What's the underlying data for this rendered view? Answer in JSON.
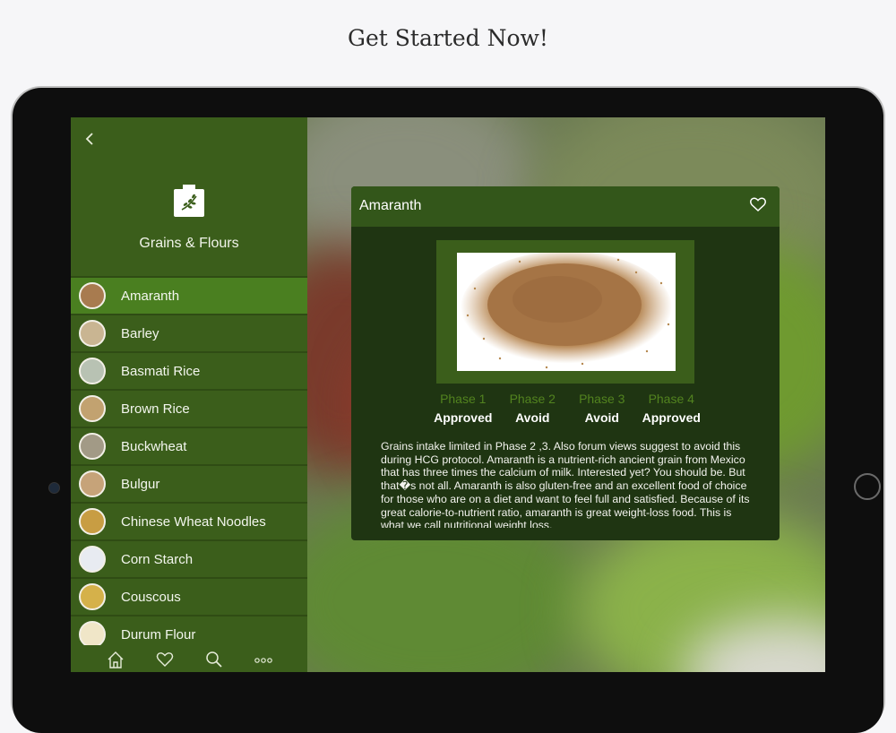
{
  "headline": "Get Started Now!",
  "sidebar": {
    "category_title": "Grains & Flours",
    "items": [
      {
        "label": "Amaranth",
        "selected": true,
        "color": "#a87b4f"
      },
      {
        "label": "Barley",
        "selected": false,
        "color": "#c9b592"
      },
      {
        "label": "Basmati Rice",
        "selected": false,
        "color": "#b8c2b3"
      },
      {
        "label": "Brown Rice",
        "selected": false,
        "color": "#c2a270"
      },
      {
        "label": "Buckwheat",
        "selected": false,
        "color": "#a29a86"
      },
      {
        "label": "Bulgur",
        "selected": false,
        "color": "#c6a379"
      },
      {
        "label": "Chinese Wheat Noodles",
        "selected": false,
        "color": "#c89d43"
      },
      {
        "label": "Corn Starch",
        "selected": false,
        "color": "#e8ebf1"
      },
      {
        "label": "Couscous",
        "selected": false,
        "color": "#d5b14a"
      },
      {
        "label": "Durum Flour",
        "selected": false,
        "color": "#f0e6c8"
      }
    ],
    "tabs": [
      "home-icon",
      "heart-icon",
      "search-icon",
      "more-icon"
    ]
  },
  "detail": {
    "title": "Amaranth",
    "phases": [
      {
        "name": "Phase 1",
        "status": "Approved"
      },
      {
        "name": "Phase 2",
        "status": "Avoid"
      },
      {
        "name": "Phase 3",
        "status": "Avoid"
      },
      {
        "name": "Phase 4",
        "status": "Approved"
      }
    ],
    "description": "Grains intake limited in Phase 2 ,3. Also forum views suggest to avoid this during HCG protocol. Amaranth is a nutrient-rich ancient grain from Mexico that has three times the calcium of milk. Interested yet? You should be. But that�s not all. Amaranth is also gluten-free and an excellent food of choice for those who are on a diet and want to feel full and satisfied. Because of its great calorie-to-nutrient ratio, amaranth is great weight-loss food. This is what we call nutritional weight loss."
  },
  "colors": {
    "sidebar": "#3b5e1b",
    "selected": "#4a7f20",
    "card": "#1f3512",
    "card_header": "#33561a",
    "phase_label": "#52831f"
  }
}
